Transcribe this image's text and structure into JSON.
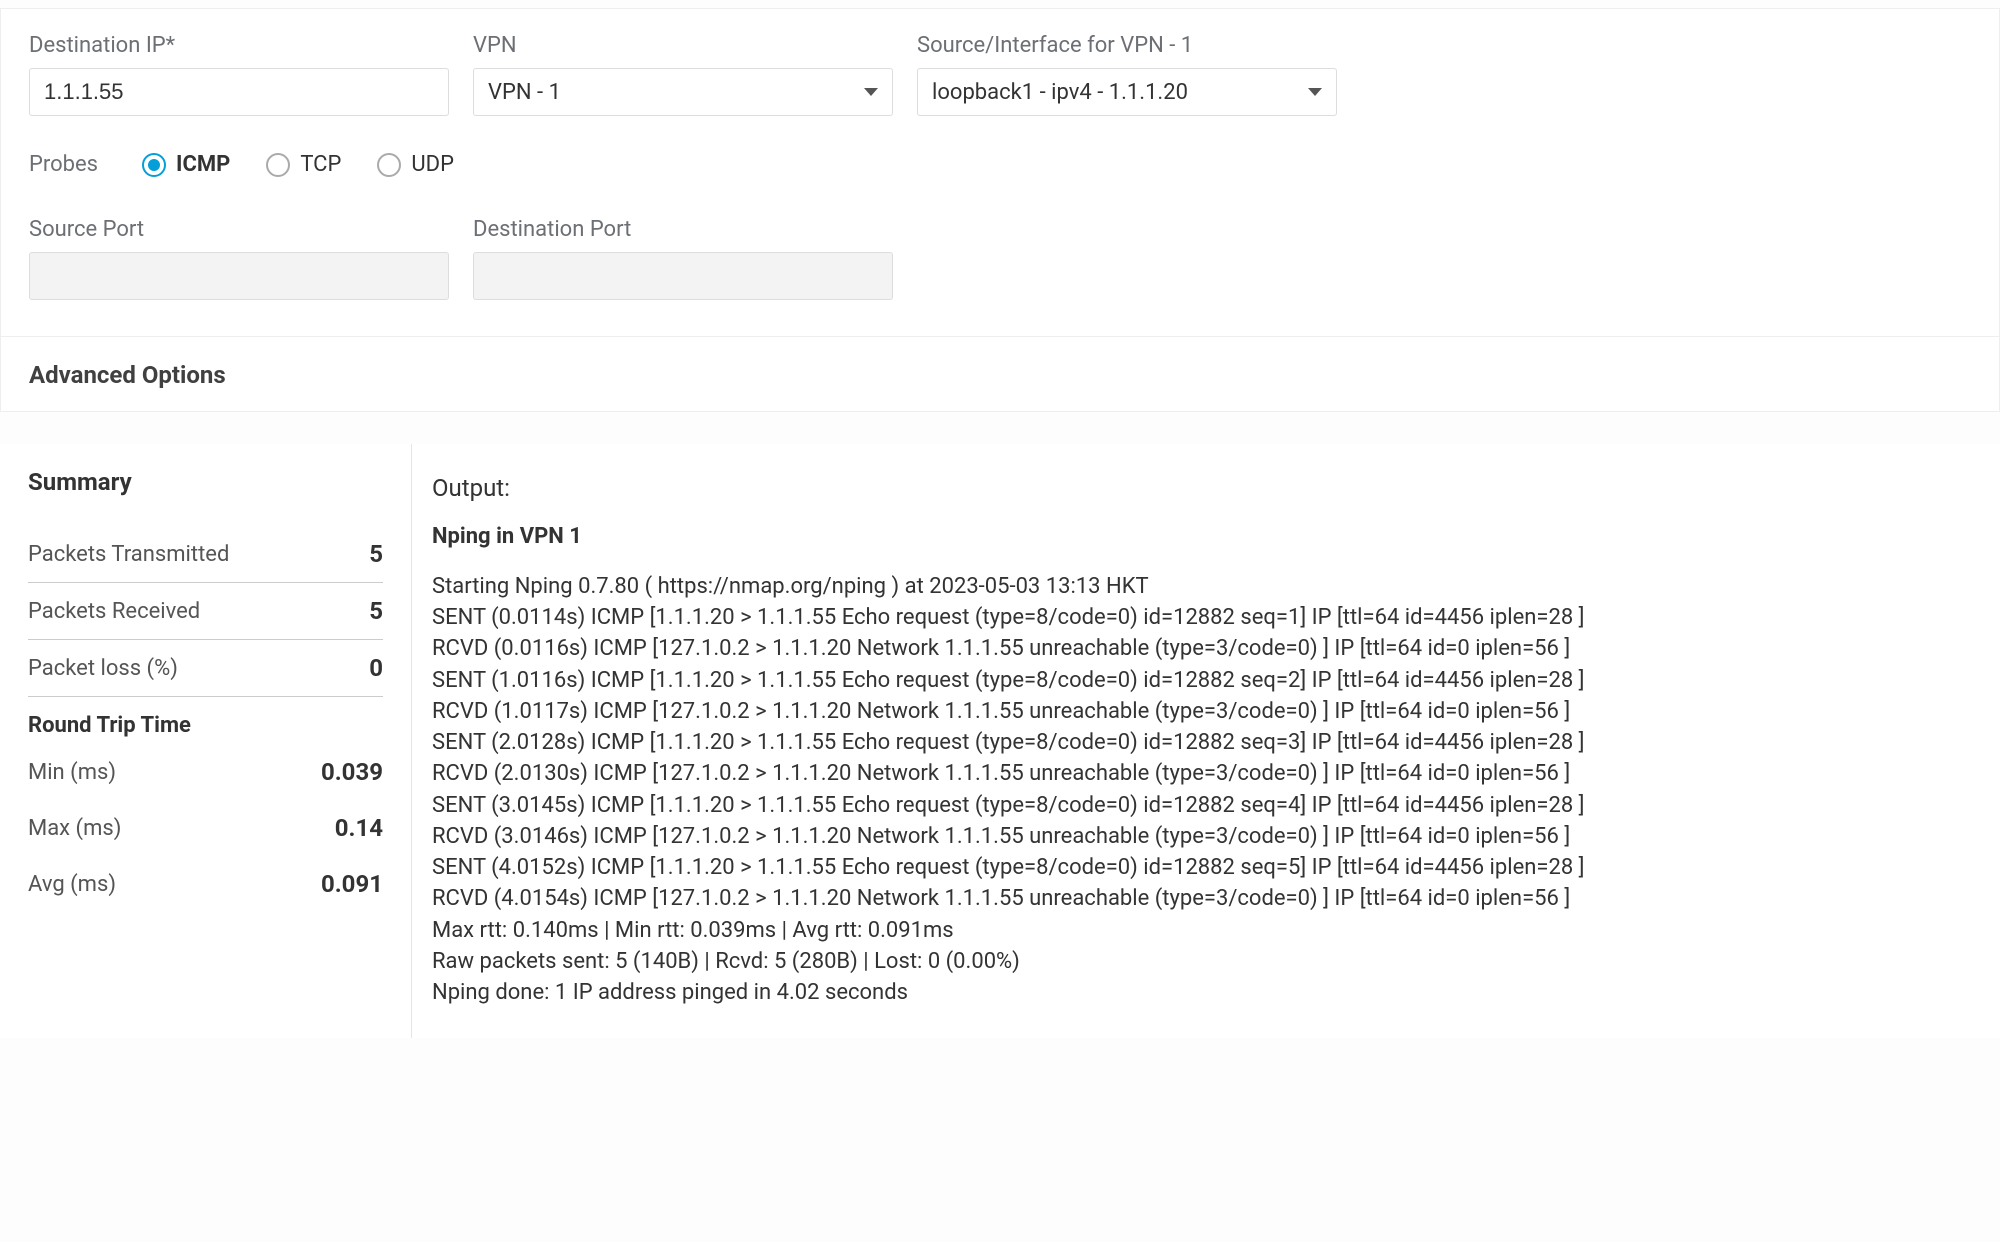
{
  "form": {
    "destIpLabel": "Destination IP*",
    "destIpValue": "1.1.1.55",
    "vpnLabel": "VPN",
    "vpnValue": "VPN - 1",
    "sourceIfLabel": "Source/Interface for VPN - 1",
    "sourceIfValue": "loopback1 - ipv4 - 1.1.1.20",
    "probesLabel": "Probes",
    "probes": [
      {
        "label": "ICMP",
        "selected": true
      },
      {
        "label": "TCP",
        "selected": false
      },
      {
        "label": "UDP",
        "selected": false
      }
    ],
    "sourcePortLabel": "Source Port",
    "sourcePortValue": "",
    "destPortLabel": "Destination Port",
    "destPortValue": "",
    "advancedLabel": "Advanced Options"
  },
  "summary": {
    "title": "Summary",
    "packetsTxLabel": "Packets Transmitted",
    "packetsTxValue": "5",
    "packetsRxLabel": "Packets Received",
    "packetsRxValue": "5",
    "packetLossLabel": "Packet loss (%)",
    "packetLossValue": "0",
    "rttTitle": "Round Trip Time",
    "minLabel": "Min (ms)",
    "minValue": "0.039",
    "maxLabel": "Max (ms)",
    "maxValue": "0.14",
    "avgLabel": "Avg (ms)",
    "avgValue": "0.091"
  },
  "output": {
    "label": "Output:",
    "title": "Nping in VPN 1",
    "lines": [
      "Starting Nping 0.7.80 ( https://nmap.org/nping ) at 2023-05-03 13:13 HKT",
      "SENT (0.0114s) ICMP [1.1.1.20 > 1.1.1.55 Echo request (type=8/code=0) id=12882 seq=1] IP [ttl=64 id=4456 iplen=28 ]",
      "RCVD (0.0116s) ICMP [127.1.0.2 > 1.1.1.20 Network 1.1.1.55 unreachable (type=3/code=0) ] IP [ttl=64 id=0 iplen=56 ]",
      "SENT (1.0116s) ICMP [1.1.1.20 > 1.1.1.55 Echo request (type=8/code=0) id=12882 seq=2] IP [ttl=64 id=4456 iplen=28 ]",
      "RCVD (1.0117s) ICMP [127.1.0.2 > 1.1.1.20 Network 1.1.1.55 unreachable (type=3/code=0) ] IP [ttl=64 id=0 iplen=56 ]",
      "SENT (2.0128s) ICMP [1.1.1.20 > 1.1.1.55 Echo request (type=8/code=0) id=12882 seq=3] IP [ttl=64 id=4456 iplen=28 ]",
      "RCVD (2.0130s) ICMP [127.1.0.2 > 1.1.1.20 Network 1.1.1.55 unreachable (type=3/code=0) ] IP [ttl=64 id=0 iplen=56 ]",
      "SENT (3.0145s) ICMP [1.1.1.20 > 1.1.1.55 Echo request (type=8/code=0) id=12882 seq=4] IP [ttl=64 id=4456 iplen=28 ]",
      "RCVD (3.0146s) ICMP [127.1.0.2 > 1.1.1.20 Network 1.1.1.55 unreachable (type=3/code=0) ] IP [ttl=64 id=0 iplen=56 ]",
      "SENT (4.0152s) ICMP [1.1.1.20 > 1.1.1.55 Echo request (type=8/code=0) id=12882 seq=5] IP [ttl=64 id=4456 iplen=28 ]",
      "RCVD (4.0154s) ICMP [127.1.0.2 > 1.1.1.20 Network 1.1.1.55 unreachable (type=3/code=0) ] IP [ttl=64 id=0 iplen=56 ]",
      "Max rtt: 0.140ms | Min rtt: 0.039ms | Avg rtt: 0.091ms",
      "Raw packets sent: 5 (140B) | Rcvd: 5 (280B) | Lost: 0 (0.00%)",
      "Nping done: 1 IP address pinged in 4.02 seconds"
    ]
  }
}
